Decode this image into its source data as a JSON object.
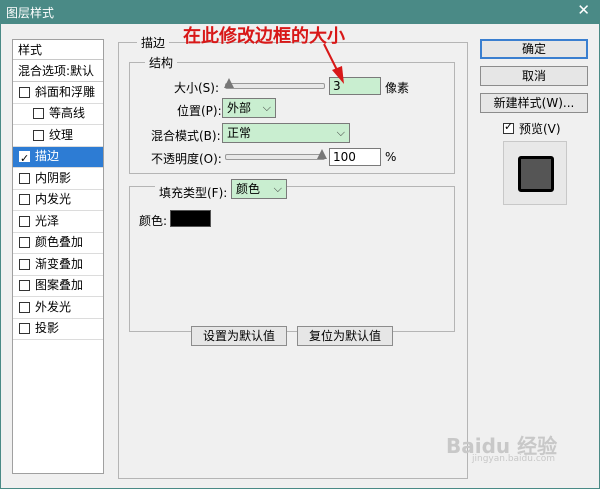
{
  "window": {
    "title": "图层样式",
    "close_symbol": "✕"
  },
  "sidebar": {
    "header": "样式",
    "blend_header": "混合选项:默认",
    "items": [
      {
        "label": "斜面和浮雕",
        "checked": false
      },
      {
        "label": "等高线",
        "checked": false
      },
      {
        "label": "纹理",
        "checked": false
      },
      {
        "label": "描边",
        "checked": true
      },
      {
        "label": "内阴影",
        "checked": false
      },
      {
        "label": "内发光",
        "checked": false
      },
      {
        "label": "光泽",
        "checked": false
      },
      {
        "label": "颜色叠加",
        "checked": false
      },
      {
        "label": "渐变叠加",
        "checked": false
      },
      {
        "label": "图案叠加",
        "checked": false
      },
      {
        "label": "外发光",
        "checked": false
      },
      {
        "label": "投影",
        "checked": false
      }
    ]
  },
  "stroke": {
    "section_title": "描边",
    "structure_title": "结构",
    "size_label": "大小(S):",
    "size_value": "3",
    "size_unit": "像素",
    "position_label": "位置(P):",
    "position_value": "外部",
    "blend_label": "混合模式(B):",
    "blend_value": "正常",
    "opacity_label": "不透明度(O):",
    "opacity_value": "100",
    "opacity_unit": "%",
    "fill_type_label": "填充类型(F):",
    "fill_type_value": "颜色",
    "color_label": "颜色:",
    "color_hex": "#000000",
    "set_default": "设置为默认值",
    "reset_default": "复位为默认值"
  },
  "annotation": {
    "text": "在此修改边框的大小"
  },
  "actions": {
    "ok": "确定",
    "cancel": "取消",
    "new_style": "新建样式(W)...",
    "preview_label": "预览(V)",
    "preview_checked": true
  },
  "watermark": {
    "text": "Baidu 经验",
    "sub": "jingyan.baidu.com"
  }
}
